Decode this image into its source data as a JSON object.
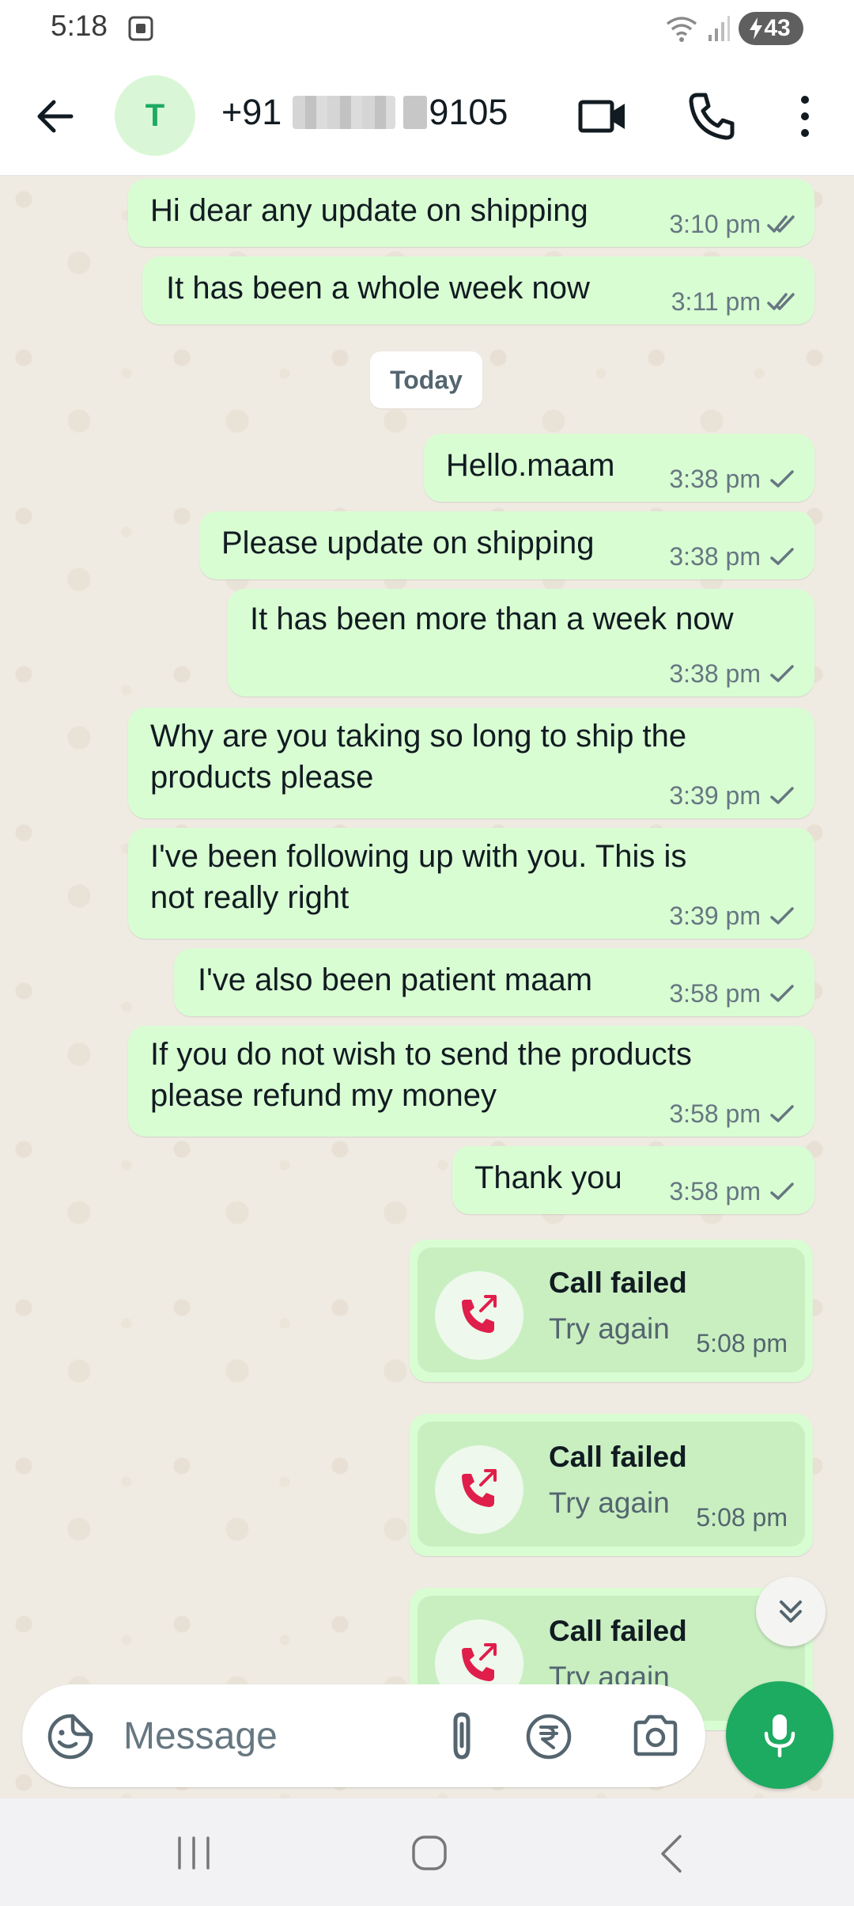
{
  "status_bar": {
    "time": "5:18",
    "battery": "43"
  },
  "header": {
    "avatar_letter": "T",
    "contact_prefix": "+91",
    "contact_suffix": "9105"
  },
  "date_separator": "Today",
  "messages": [
    {
      "text": "Hi dear any update on shipping",
      "time": "3:10 pm",
      "status": "read"
    },
    {
      "text": "It has been a whole week now",
      "time": "3:11 pm",
      "status": "read"
    },
    {
      "text": "Hello.maam",
      "time": "3:38 pm",
      "status": "sent"
    },
    {
      "text": "Please update on shipping",
      "time": "3:38 pm",
      "status": "sent"
    },
    {
      "text": "It has been more than a week now",
      "time": "3:38 pm",
      "status": "sent"
    },
    {
      "line1": "Why are you taking so long to ship the",
      "line2": "products please",
      "time": "3:39 pm",
      "status": "sent"
    },
    {
      "line1": "I've been following up with you.  This is",
      "line2": "not really right",
      "time": "3:39 pm",
      "status": "sent"
    },
    {
      "text": "I've also been patient maam",
      "time": "3:58 pm",
      "status": "sent"
    },
    {
      "line1": "If you do not wish to send the products",
      "line2": "please refund my money",
      "time": "3:58 pm",
      "status": "sent"
    },
    {
      "text": "Thank you",
      "time": "3:58 pm",
      "status": "sent"
    }
  ],
  "calls": [
    {
      "title": "Call failed",
      "subtitle": "Try again",
      "time": "5:08 pm"
    },
    {
      "title": "Call failed",
      "subtitle": "Try again",
      "time": "5:08 pm"
    },
    {
      "title": "Call failed",
      "subtitle": "Try again",
      "time": ""
    }
  ],
  "composer": {
    "placeholder": "Message"
  },
  "colors": {
    "bubble_out": "#d9fdd3",
    "chat_bg": "#efeae2",
    "accent_green": "#1daa61",
    "call_failed_red": "#e01e4b"
  }
}
